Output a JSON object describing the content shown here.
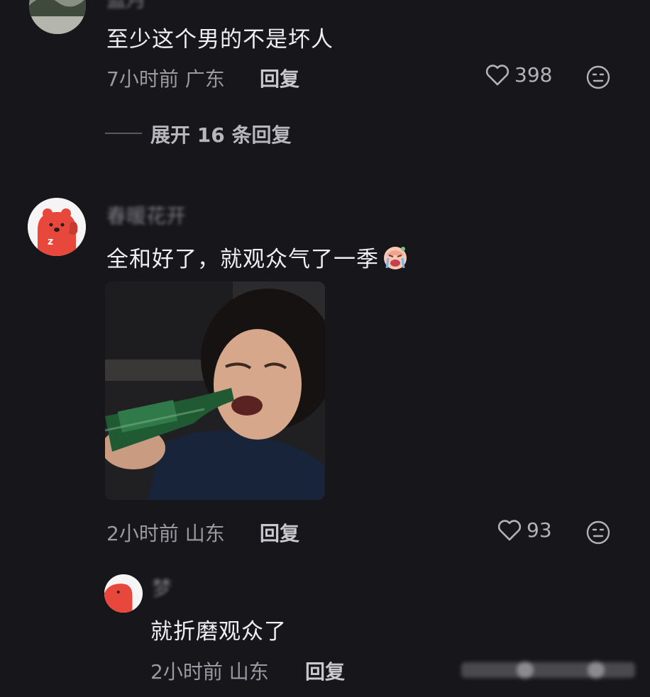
{
  "comment1": {
    "username": "蓝月",
    "text": "至少这个男的不是坏人",
    "time_location": "7小时前 广东",
    "reply_label": "回复",
    "likes": "398",
    "expand_label": "展开 16 条回复"
  },
  "comment2": {
    "username": "春暖花开",
    "text": "全和好了，就观众气了一季",
    "time_location": "2小时前 山东",
    "reply_label": "回复",
    "likes": "93"
  },
  "reply": {
    "username": "梦",
    "text": "就折磨观众了",
    "time_location": "2小时前 山东",
    "reply_label": "回复"
  },
  "colors": {
    "background": "#17161b",
    "text_primary": "#efeff2",
    "text_secondary": "#9b9aa2",
    "avatar_red": "#e8473c"
  },
  "icons": [
    "heart-outline-icon",
    "dislike-face-icon",
    "crying-emoji-icon"
  ]
}
